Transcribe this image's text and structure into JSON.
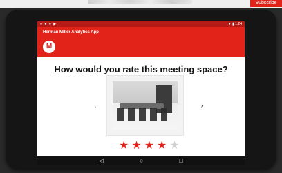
{
  "app": {
    "title": "Herman Miller Analytics App",
    "logo_letter": "M",
    "brand_color": "#e2231a"
  },
  "top_tag": "Subscribe",
  "status_bar": {
    "left_icons": "● ● ● ▶",
    "right": "▼ ▮ 1:24"
  },
  "question": "How would you rate this meeting space?",
  "rating": {
    "value": 4,
    "max": 5,
    "star_glyph": "★"
  },
  "icons": {
    "prev": "arrow-left-icon",
    "next": "arrow-right-icon",
    "back": "back-icon",
    "home": "home-icon",
    "recents": "recents-icon"
  },
  "glyphs": {
    "prev": "‹",
    "next": "›",
    "back": "◁",
    "home": "○",
    "recents": "□"
  }
}
